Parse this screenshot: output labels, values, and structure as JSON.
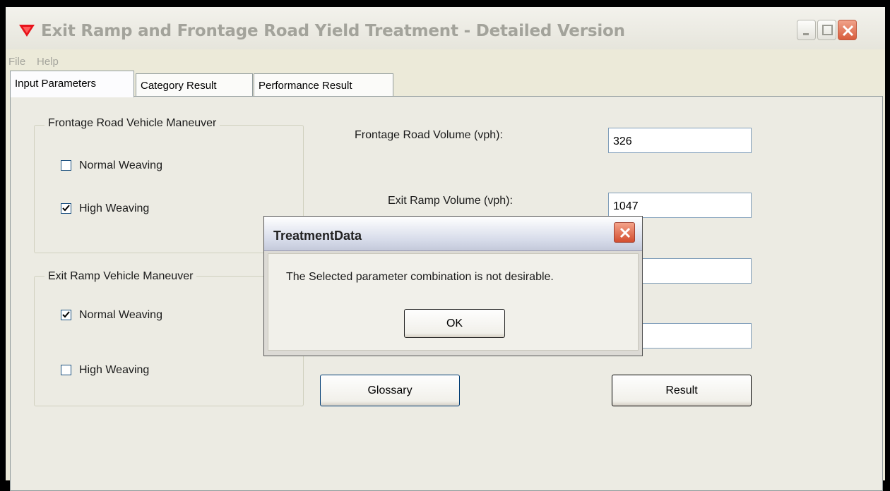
{
  "window": {
    "title": "Exit Ramp and Frontage Road Yield Treatment - Detailed Version"
  },
  "menu": {
    "items": [
      "File",
      "Help"
    ]
  },
  "tabs": [
    {
      "label": "Input Parameters"
    },
    {
      "label": "Category Result"
    },
    {
      "label": "Performance Result"
    }
  ],
  "frontage_group": {
    "label": "Frontage Road Vehicle Maneuver",
    "options": [
      {
        "label": "Normal Weaving",
        "checked": false
      },
      {
        "label": "High Weaving",
        "checked": true
      }
    ]
  },
  "exit_group": {
    "label": "Exit Ramp Vehicle Maneuver",
    "options": [
      {
        "label": "Normal Weaving",
        "checked": true
      },
      {
        "label": "High Weaving",
        "checked": false
      }
    ]
  },
  "fields": {
    "frontage_volume_label": "Frontage Road Volume (vph):",
    "frontage_volume_value": "326",
    "exit_volume_label": "Exit Ramp Volume (vph):",
    "exit_volume_value": "1047",
    "field3_value": "",
    "field4_value": ""
  },
  "buttons": {
    "glossary": "Glossary",
    "result": "Result"
  },
  "dialog": {
    "title": "TreatmentData",
    "message": "The Selected parameter combination is not desirable.",
    "ok": "OK"
  },
  "colors": {
    "dialog_close": "#d34d2f",
    "window_close": "#d85c3c",
    "app_icon": "#e8131b"
  }
}
